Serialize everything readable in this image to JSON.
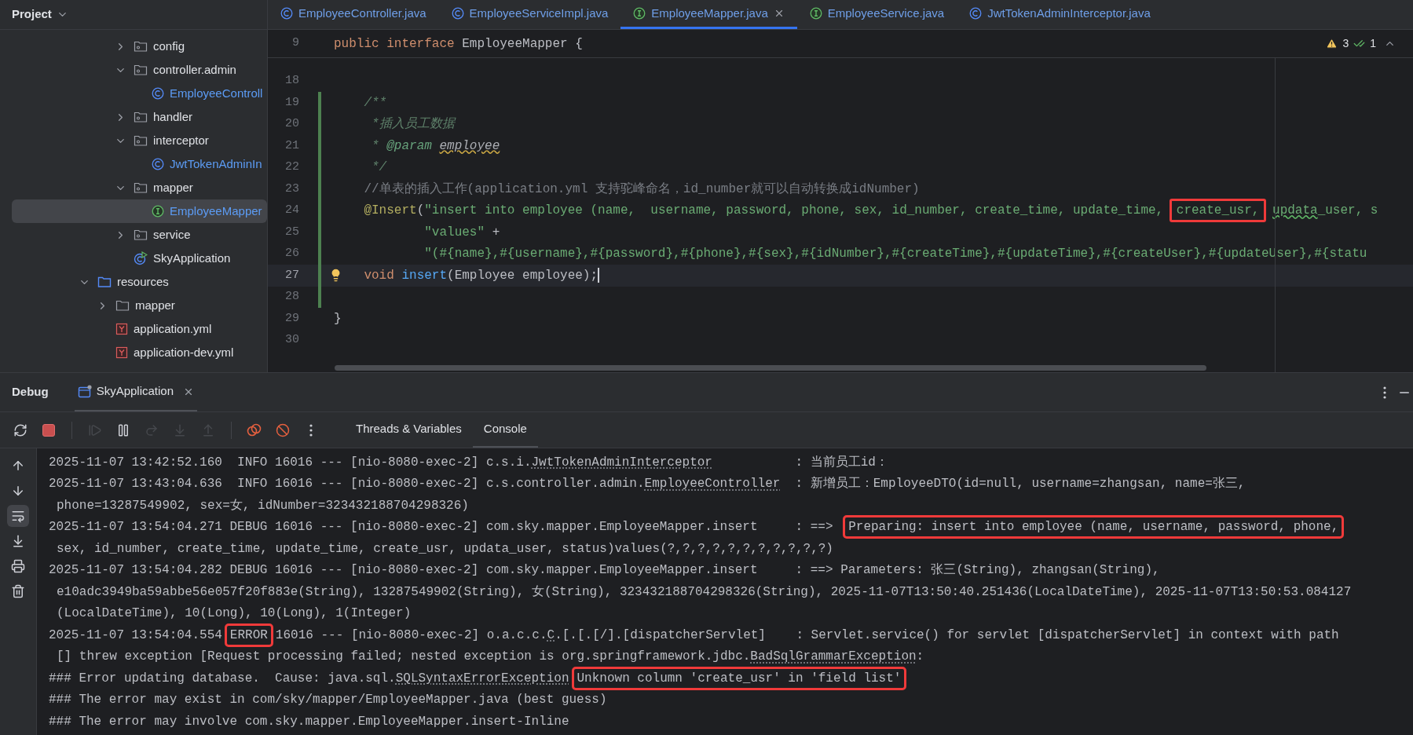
{
  "project_panel": {
    "title": "Project",
    "tree_continuation": [
      {
        "label": "config",
        "kind": "package",
        "expanded": false,
        "selected": false
      },
      {
        "label": "controller.admin",
        "kind": "package",
        "expanded": true,
        "selected": false,
        "children": [
          {
            "label": "EmployeeControll",
            "kind": "class",
            "selected": false
          }
        ]
      },
      {
        "label": "handler",
        "kind": "package",
        "expanded": false,
        "selected": false
      },
      {
        "label": "interceptor",
        "kind": "package",
        "expanded": true,
        "selected": false,
        "children": [
          {
            "label": "JwtTokenAdminIn",
            "kind": "class",
            "selected": false
          }
        ]
      },
      {
        "label": "mapper",
        "kind": "package",
        "expanded": true,
        "selected": false,
        "children": [
          {
            "label": "EmployeeMapper",
            "kind": "interface",
            "selected": true
          }
        ]
      },
      {
        "label": "service",
        "kind": "package",
        "expanded": false,
        "selected": false
      },
      {
        "label": "SkyApplication",
        "kind": "app",
        "selected": false
      }
    ],
    "tree_items": [
      {
        "label": "resources",
        "kind": "resource_root",
        "expanded": true,
        "selected": false,
        "children": [
          {
            "label": "mapper",
            "kind": "folder",
            "expanded": false,
            "selected": false
          },
          {
            "label": "application.yml",
            "kind": "yaml",
            "selected": false
          },
          {
            "label": "application-dev.yml",
            "kind": "yaml",
            "selected": false
          }
        ]
      }
    ]
  },
  "editor_tabs": [
    {
      "label": "EmployeeController.java",
      "kind": "class",
      "selected": false,
      "closable": false
    },
    {
      "label": "EmployeeServiceImpl.java",
      "kind": "class",
      "selected": false,
      "closable": false
    },
    {
      "label": "EmployeeMapper.java",
      "kind": "interface",
      "selected": true,
      "closable": true
    },
    {
      "label": "EmployeeService.java",
      "kind": "interface",
      "selected": false,
      "closable": false
    },
    {
      "label": "JwtTokenAdminInterceptor.java",
      "kind": "class",
      "selected": false,
      "closable": false
    }
  ],
  "editor": {
    "sticky_line": {
      "number": "9",
      "tokens": [
        {
          "text": "public interface ",
          "kind": "keyword"
        },
        {
          "text": "EmployeeMapper {",
          "kind": "plain"
        }
      ]
    },
    "inspections": {
      "warnings": "3",
      "passed": "1"
    },
    "lines": [
      {
        "number": "18",
        "current": false,
        "changed": false,
        "bulb": false
      },
      {
        "number": "19",
        "current": false,
        "changed": true,
        "bulb": false,
        "tokens": [
          {
            "text": "    /**",
            "kind": "doc"
          }
        ]
      },
      {
        "number": "20",
        "current": false,
        "changed": true,
        "bulb": false,
        "tokens": [
          {
            "text": "     *插入员工数据",
            "kind": "doc"
          }
        ]
      },
      {
        "number": "21",
        "current": false,
        "changed": true,
        "bulb": false,
        "tokens": [
          {
            "text": "     * ",
            "kind": "doc"
          },
          {
            "text": "@param",
            "kind": "doctag"
          },
          {
            "text": " employee",
            "kind": "docparam"
          }
        ]
      },
      {
        "number": "22",
        "current": false,
        "changed": true,
        "bulb": false,
        "tokens": [
          {
            "text": "     */",
            "kind": "doc"
          }
        ]
      },
      {
        "number": "23",
        "current": false,
        "changed": true,
        "bulb": false,
        "tokens": [
          {
            "text": "    //单表的插入工作(application.yml 支持驼峰命名，id_number就可以自动转换成idNumber)",
            "kind": "comment"
          }
        ]
      },
      {
        "number": "24",
        "current": false,
        "changed": true,
        "bulb": false,
        "tokens": [
          {
            "text": "    @Insert",
            "kind": "annotation"
          },
          {
            "text": "(",
            "kind": "plain"
          },
          {
            "text": "\"insert into employee (name,  username, password, phone, sex, id_number, create_time, update_time, ",
            "kind": "string"
          },
          {
            "text": "create_usr,",
            "kind": "string",
            "boxed": true
          },
          {
            "text": " updata",
            "kind": "typo"
          },
          {
            "text": "_user, s",
            "kind": "string"
          }
        ]
      },
      {
        "number": "25",
        "current": false,
        "changed": true,
        "bulb": false,
        "tokens": [
          {
            "text": "            \"values\"",
            "kind": "string"
          },
          {
            "text": " +",
            "kind": "plain"
          }
        ]
      },
      {
        "number": "26",
        "current": false,
        "changed": true,
        "bulb": false,
        "tokens": [
          {
            "text": "            \"(#{name},#{username},#{password},#{phone},#{sex},#{idNumber},#{createTime},#{updateTime},#{createUser},#{updateUser},#{statu",
            "kind": "string"
          }
        ]
      },
      {
        "number": "27",
        "current": true,
        "changed": true,
        "bulb": true,
        "tokens": [
          {
            "text": "    void ",
            "kind": "keyword"
          },
          {
            "text": "insert",
            "kind": "method"
          },
          {
            "text": "(Employee employee);",
            "kind": "plain"
          }
        ]
      },
      {
        "number": "28",
        "current": false,
        "changed": true,
        "bulb": false
      },
      {
        "number": "29",
        "current": false,
        "changed": false,
        "bulb": false,
        "tokens": [
          {
            "text": "}",
            "kind": "plain"
          }
        ]
      },
      {
        "number": "30",
        "current": false,
        "changed": false,
        "bulb": false
      }
    ]
  },
  "debug_panel": {
    "title": "Debug",
    "session_tab": "SkyApplication",
    "toolbar": [
      {
        "kind": "rerun",
        "disabled": false
      },
      {
        "kind": "stop",
        "disabled": false
      },
      {
        "kind": "separator"
      },
      {
        "kind": "resume",
        "disabled": true
      },
      {
        "kind": "pause",
        "disabled": false
      },
      {
        "kind": "step_over",
        "disabled": true
      },
      {
        "kind": "step_into",
        "disabled": true
      },
      {
        "kind": "step_out",
        "disabled": true
      },
      {
        "kind": "separator"
      },
      {
        "kind": "breakpoints",
        "disabled": false
      },
      {
        "kind": "mute",
        "disabled": false
      },
      {
        "kind": "more",
        "disabled": false
      }
    ],
    "tabs": [
      {
        "label": "Threads & Variables",
        "selected": false
      },
      {
        "label": "Console",
        "selected": true
      }
    ],
    "console_tools": [
      {
        "kind": "up",
        "selected": false
      },
      {
        "kind": "down",
        "selected": false
      },
      {
        "kind": "wrap",
        "selected": true
      },
      {
        "kind": "scroll_end",
        "selected": false
      },
      {
        "kind": "print",
        "selected": false
      },
      {
        "kind": "clear",
        "selected": false
      }
    ],
    "console_lines": [
      {
        "wrapped": false,
        "segments": [
          {
            "text": "2025-11-07 13:42:52.160  INFO 16016 --- [nio-8080-exec-2] c.s.i.",
            "kind": "plain"
          },
          {
            "text": "JwtTokenAdminInterceptor",
            "kind": "link"
          },
          {
            "text": "           : 当前员工id：",
            "kind": "plain"
          }
        ]
      },
      {
        "wrapped": false,
        "segments": [
          {
            "text": "2025-11-07 13:43:04.636  INFO 16016 --- [nio-8080-exec-2] c.s.controller.admin.",
            "kind": "plain"
          },
          {
            "text": "EmployeeController",
            "kind": "link"
          },
          {
            "text": "  : 新增员工：EmployeeDTO(id=null, username=zhangsan, name=张三,",
            "kind": "plain"
          }
        ]
      },
      {
        "wrapped": true,
        "segments": [
          {
            "text": "phone=13287549902, sex=女, idNumber=323432188704298326)",
            "kind": "plain"
          }
        ]
      },
      {
        "wrapped": false,
        "segments": [
          {
            "text": "2025-11-07 13:54:04.271 DEBUG 16016 --- [nio-8080-exec-2] com.sky.mapper.EmployeeMapper.insert     : ==> ",
            "kind": "plain"
          },
          {
            "text": "Preparing: insert into employee (name, username, password, phone,",
            "kind": "boxed"
          }
        ]
      },
      {
        "wrapped": true,
        "segments": [
          {
            "text": "sex, id_number, create_time, update_time, create_usr, updata_user, status)values(?,?,?,?,?,?,?,?,?,?,?)",
            "kind": "plain"
          }
        ]
      },
      {
        "wrapped": false,
        "segments": [
          {
            "text": "2025-11-07 13:54:04.282 DEBUG 16016 --- [nio-8080-exec-2] com.sky.mapper.EmployeeMapper.insert     : ==> Parameters: 张三(String), zhangsan(String),",
            "kind": "plain"
          }
        ]
      },
      {
        "wrapped": true,
        "segments": [
          {
            "text": "e10adc3949ba59abbe56e057f20f883e(String), 13287549902(String), 女(String), 323432188704298326(String), 2025-11-07T13:50:40.251436(LocalDateTime), 2025-11-07T13:50:53.084127",
            "kind": "plain"
          }
        ]
      },
      {
        "wrapped": true,
        "segments": [
          {
            "text": "(LocalDateTime), 10(Long), 10(Long), 1(Integer)",
            "kind": "plain"
          }
        ]
      },
      {
        "wrapped": false,
        "segments": [
          {
            "text": "2025-11-07 13:54:04.554",
            "kind": "plain"
          },
          {
            "text": "ERROR",
            "kind": "boxed"
          },
          {
            "text": "16016 --- [nio-8080-exec-2] o.a.c.c.",
            "kind": "plain"
          },
          {
            "text": "C",
            "kind": "link"
          },
          {
            "text": ".[.[.[/].[dispatcherServlet]    : Servlet.service() for servlet [dispatcherServlet] in context with path",
            "kind": "plain"
          }
        ]
      },
      {
        "wrapped": true,
        "segments": [
          {
            "text": "[] threw exception [Request processing failed; nested exception is org.springframework.jdbc.",
            "kind": "plain"
          },
          {
            "text": "BadSqlGrammarException",
            "kind": "link"
          },
          {
            "text": ":",
            "kind": "plain"
          }
        ]
      },
      {
        "wrapped": false,
        "segments": [
          {
            "text": "### Error updating database.  Cause: java.sql.",
            "kind": "plain"
          },
          {
            "text": "SQLSyntaxErrorException",
            "kind": "link"
          },
          {
            "text": "Unknown column 'create_usr' in 'field list'",
            "kind": "boxed"
          }
        ]
      },
      {
        "wrapped": false,
        "segments": [
          {
            "text": "### The error may exist in com/sky/mapper/EmployeeMapper.java (best guess)",
            "kind": "plain"
          }
        ]
      },
      {
        "wrapped": false,
        "segments": [
          {
            "text": "### The error may involve com.sky.mapper.EmployeeMapper.insert-Inline",
            "kind": "plain"
          }
        ]
      }
    ]
  }
}
